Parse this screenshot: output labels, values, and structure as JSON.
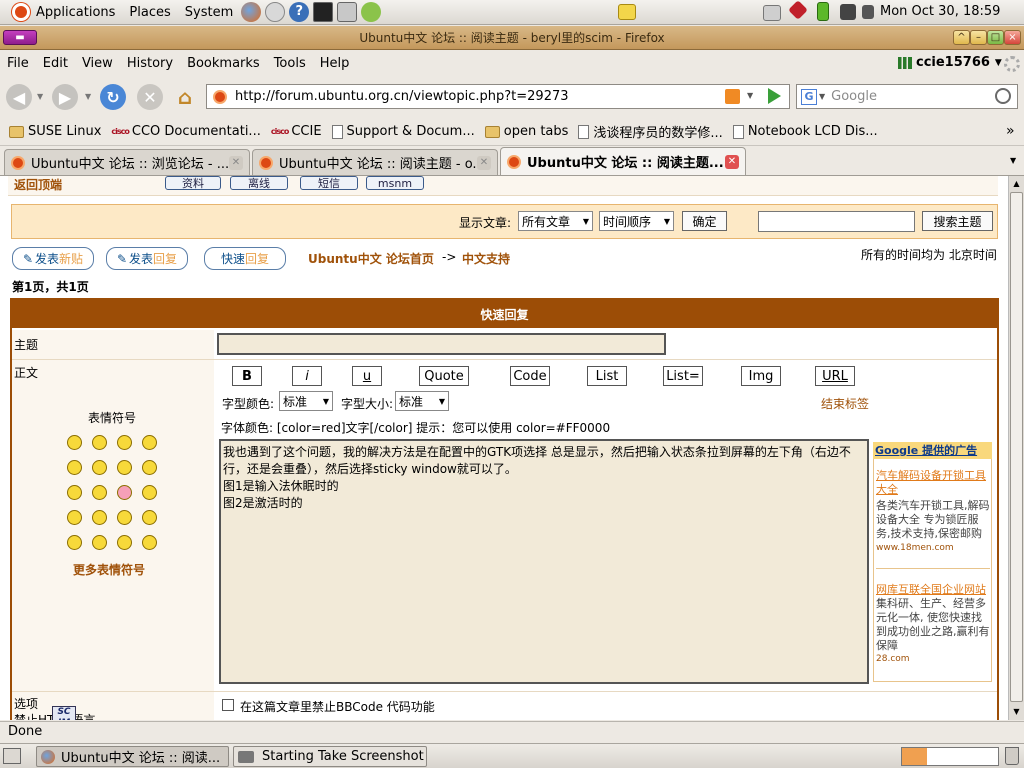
{
  "panel": {
    "applications": "Applications",
    "places": "Places",
    "system": "System",
    "clock": "Mon Oct 30, 18:59"
  },
  "window": {
    "title": "Ubuntu中文 论坛 :: 阅读主题 - beryl里的scim - Firefox"
  },
  "menubar": {
    "items": [
      "File",
      "Edit",
      "View",
      "History",
      "Bookmarks",
      "Tools",
      "Help"
    ],
    "user": "ccie15766"
  },
  "navbar": {
    "url": "http://forum.ubuntu.org.cn/viewtopic.php?t=29273",
    "search_placeholder": "Google"
  },
  "bookmarks": {
    "items": [
      "SUSE Linux",
      "CCO Documentati...",
      "CCIE",
      "Support & Docum...",
      "open tabs",
      "浅谈程序员的数学修...",
      "Notebook LCD Dis..."
    ],
    "more": "»"
  },
  "tabs": [
    {
      "label": "Ubuntu中文 论坛 :: 浏览论坛 - ..."
    },
    {
      "label": "Ubuntu中文 论坛 :: 阅读主题 - o..."
    },
    {
      "label": "Ubuntu中文 论坛 :: 阅读主题..."
    }
  ],
  "page": {
    "back_to_top": "返回顶端",
    "profile_buttons": [
      "资料",
      "离线",
      "短信",
      "msnm"
    ],
    "display_label": "显示文章:",
    "display_select": "所有文章",
    "order_select": "时间顺序",
    "confirm": "确定",
    "search_topic": "搜索主题",
    "new_topic": [
      "发表",
      "新贴"
    ],
    "reply": [
      "发表",
      "回复"
    ],
    "quick_reply_btn": [
      "快速",
      "回复"
    ],
    "forum_index": "Ubuntu中文 论坛首页",
    "arrow": "->",
    "forum_name": "中文支持",
    "timezone": "所有的时间均为 北京时间",
    "page_info": "第1页，共1页",
    "quick_reply_title": "快速回复",
    "subject_label": "主题",
    "body_label": "正文",
    "emoticons_label": "表情符号",
    "more_emoticons": "更多表情符号",
    "format_buttons": [
      "B",
      "i",
      "u",
      "Quote",
      "Code",
      "List",
      "List=",
      "Img",
      "URL"
    ],
    "font_color_label": "字型颜色:",
    "font_color_value": "标准",
    "font_size_label": "字型大小:",
    "font_size_value": "标准",
    "close_tags": "结束标签",
    "color_hint": "字体颜色: [color=red]文字[/color]  提示：您可以使用 color=#FF0000",
    "message_text": "我也遇到了这个问题，我的解决方法是在配置中的GTK项选择 总是显示，然后把输入状态条拉到屏幕的左下角（右边不行，还是会重叠），然后选择sticky window就可以了。\n图1是输入法休眠时的\n图2是激活时的",
    "options_label": "选项",
    "disable_html_label": "禁止HTML语言",
    "disable_bbcode": "在这篇文章里禁止BBCode 代码功能",
    "ads": {
      "header": "Google 提供的广告",
      "ad1_title": "汽车解码设备开锁工具大全",
      "ad1_body": "各类汽车开锁工具,解码设备大全 专为锁匠服务,技术支持,保密邮购",
      "ad1_url": "www.18men.com",
      "ad2_title": "网库互联全国企业网站",
      "ad2_body": "集科研、生产、经营多元化一体, 使您快速找到成功创业之路,赢利有保障",
      "ad2_url": "28.com"
    }
  },
  "status": {
    "text": "Done"
  },
  "taskbar": {
    "tasks": [
      "Ubuntu中文 论坛 :: 阅读...",
      "Starting Take Screenshot"
    ]
  },
  "colors": {
    "forum_header": "#9c4d06",
    "link_orange": "#a0520a",
    "ubuntu_orange": "#dd4814"
  }
}
